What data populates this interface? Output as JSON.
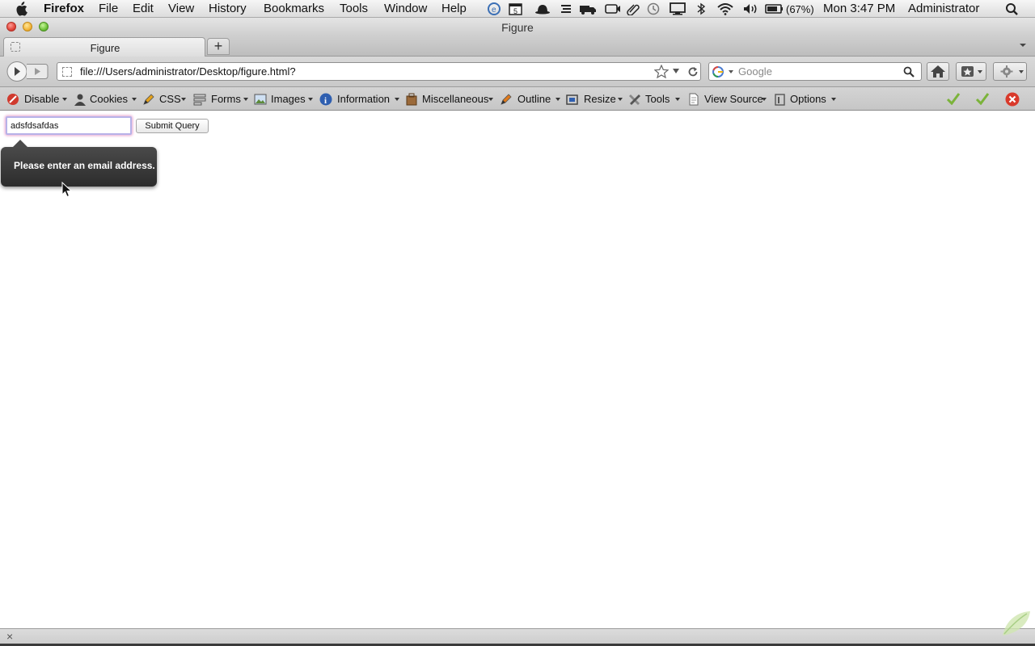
{
  "menubar": {
    "app_name": "Firefox",
    "items": [
      "File",
      "Edit",
      "View",
      "History",
      "Bookmarks",
      "Tools",
      "Window",
      "Help"
    ],
    "battery": "(67%)",
    "clock": "Mon 3:47 PM",
    "user": "Administrator"
  },
  "window": {
    "title": "Figure"
  },
  "tabs": [
    {
      "label": "Figure"
    }
  ],
  "navbar": {
    "url": "file:///Users/administrator/Desktop/figure.html?",
    "search_placeholder": "Google"
  },
  "devtoolbar": {
    "items": [
      "Disable",
      "Cookies",
      "CSS",
      "Forms",
      "Images",
      "Information",
      "Miscellaneous",
      "Outline",
      "Resize",
      "Tools",
      "View Source",
      "Options"
    ]
  },
  "page": {
    "email_value": "adsfdsafdas",
    "submit_label": "Submit Query",
    "validation_message": "Please enter an email address."
  },
  "colors": {
    "invalid_glow": "#e7a2cf",
    "tooltip_bg": "#2c2c2c"
  }
}
